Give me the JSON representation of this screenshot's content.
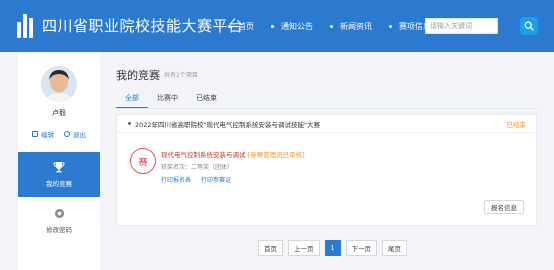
{
  "header": {
    "site_title": "四川省职业院校技能大赛平台",
    "nav": [
      "首页",
      "通知公告",
      "新闻资讯",
      "赛项信息"
    ],
    "search_placeholder": "请输入关键词"
  },
  "sidebar": {
    "username": "卢毅",
    "edit_label": "编辑",
    "logout_label": "退出",
    "menu": [
      {
        "label": "我的竞赛",
        "icon": "trophy-icon"
      },
      {
        "label": "修改密码",
        "icon": "gear-icon"
      }
    ]
  },
  "main": {
    "title": "我的竞赛",
    "count_text": "共有1个项目",
    "tabs": [
      "全部",
      "比赛中",
      "已结束"
    ],
    "card": {
      "title": "2022年四川省高职院校\"现代电气控制系统安装与调试技能\"大赛",
      "status": "已结束",
      "stamp_char": "赛",
      "event_name": "现代电气控制系统安装与调试",
      "event_tag": "[参赛管理员已审核]",
      "award": "获奖名次：二等奖（团体）",
      "link_print_form": "打印报名表",
      "link_print_ticket": "打印参赛证",
      "detail_button": "报名信息"
    },
    "pager": {
      "first": "首页",
      "prev": "上一页",
      "current": "1",
      "next": "下一页",
      "last": "尾页"
    }
  },
  "colors": {
    "primary": "#2b7ad0",
    "accent_status": "#f09a30",
    "stamp": "#d83a3a",
    "search_button": "#1aa0e8"
  }
}
